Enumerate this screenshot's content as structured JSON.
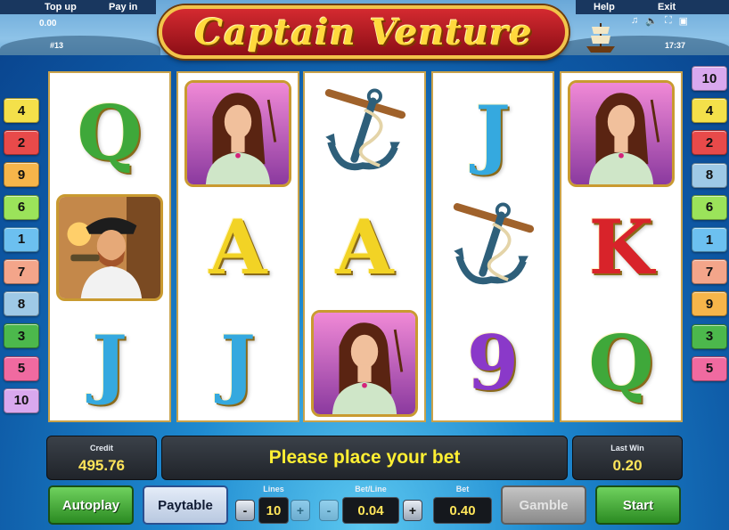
{
  "topbar": {
    "top_up": "Top up",
    "pay_in": "Pay in",
    "help": "Help",
    "exit": "Exit",
    "balance": "0.00",
    "session_id": "#13",
    "time": "17:37"
  },
  "title": "Captain Venture",
  "lines_left": [
    {
      "n": "4",
      "color": "#f4e04a"
    },
    {
      "n": "2",
      "color": "#e84a4a"
    },
    {
      "n": "9",
      "color": "#f6b54a"
    },
    {
      "n": "6",
      "color": "#9be35a"
    },
    {
      "n": "1",
      "color": "#6cc0f0"
    },
    {
      "n": "7",
      "color": "#f3a58a"
    },
    {
      "n": "8",
      "color": "#9ec9e6"
    },
    {
      "n": "3",
      "color": "#4cb84c"
    },
    {
      "n": "5",
      "color": "#f06aa0"
    },
    {
      "n": "10",
      "color": "#d9a8ee"
    }
  ],
  "lines_right": [
    {
      "n": "10",
      "color": "#d9a8ee"
    },
    {
      "n": "4",
      "color": "#f4e04a"
    },
    {
      "n": "2",
      "color": "#e84a4a"
    },
    {
      "n": "8",
      "color": "#9ec9e6"
    },
    {
      "n": "6",
      "color": "#9be35a"
    },
    {
      "n": "1",
      "color": "#6cc0f0"
    },
    {
      "n": "7",
      "color": "#f3a58a"
    },
    {
      "n": "9",
      "color": "#f6b54a"
    },
    {
      "n": "3",
      "color": "#4cb84c"
    },
    {
      "n": "5",
      "color": "#f06aa0"
    }
  ],
  "reels": [
    [
      {
        "kind": "letter",
        "text": "Q",
        "color": "#3fa83a"
      },
      {
        "kind": "captain"
      },
      {
        "kind": "letter",
        "text": "J",
        "color": "#35a9df"
      }
    ],
    [
      {
        "kind": "lady"
      },
      {
        "kind": "letter",
        "text": "A",
        "color": "#f2d325"
      },
      {
        "kind": "letter",
        "text": "J",
        "color": "#35a9df"
      }
    ],
    [
      {
        "kind": "anchor"
      },
      {
        "kind": "letter",
        "text": "A",
        "color": "#f2d325"
      },
      {
        "kind": "lady"
      }
    ],
    [
      {
        "kind": "letter",
        "text": "J",
        "color": "#35a9df"
      },
      {
        "kind": "anchor"
      },
      {
        "kind": "letter",
        "text": "9",
        "color": "#8a39c9"
      }
    ],
    [
      {
        "kind": "lady"
      },
      {
        "kind": "letter",
        "text": "K",
        "color": "#d8232a"
      },
      {
        "kind": "letter",
        "text": "Q",
        "color": "#3fa83a"
      }
    ]
  ],
  "credit": {
    "label": "Credit",
    "value": "495.76"
  },
  "message": "Please place your bet",
  "last_win": {
    "label": "Last Win",
    "value": "0.20"
  },
  "controls": {
    "autoplay": "Autoplay",
    "paytable": "Paytable",
    "lines_label": "Lines",
    "lines_value": "10",
    "betline_label": "Bet/Line",
    "betline_value": "0.04",
    "bet_label": "Bet",
    "bet_value": "0.40",
    "gamble": "Gamble",
    "start": "Start",
    "minus": "-",
    "plus": "+"
  }
}
